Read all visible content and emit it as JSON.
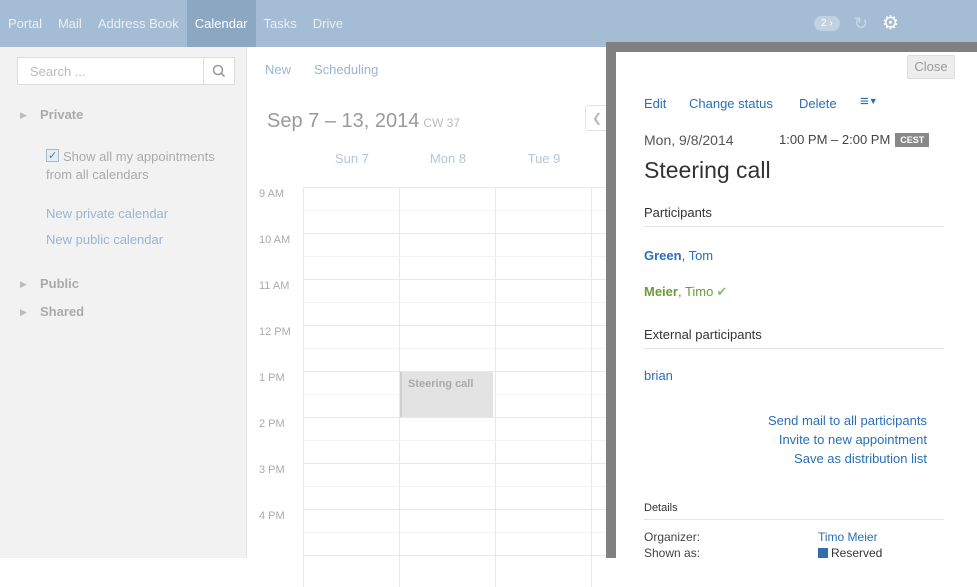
{
  "nav": {
    "tabs": [
      "Portal",
      "Mail",
      "Address Book",
      "Calendar",
      "Tasks",
      "Drive"
    ],
    "active": "Calendar",
    "notification_count": "2 ›"
  },
  "sidebar": {
    "search_placeholder": "Search ...",
    "sections": {
      "private": "Private",
      "public": "Public",
      "shared": "Shared"
    },
    "show_all_label": "Show all my appointments from all calendars",
    "new_private_calendar": "New private calendar",
    "new_public_calendar": "New public calendar"
  },
  "toolbar": {
    "new": "New",
    "scheduling": "Scheduling"
  },
  "calendar": {
    "range": "Sep 7 – 13, 2014",
    "cw": "CW 37",
    "days": [
      "Sun 7",
      "Mon 8",
      "Tue 9"
    ],
    "times": [
      "9 AM",
      "10 AM",
      "11 AM",
      "12 PM",
      "1 PM",
      "2 PM",
      "3 PM",
      "4 PM"
    ],
    "event_title": "Steering call"
  },
  "popup": {
    "close": "Close",
    "actions": {
      "edit": "Edit",
      "change_status": "Change status",
      "delete": "Delete"
    },
    "date": "Mon, 9/8/2014",
    "time": "1:00 PM – 2:00 PM",
    "timezone": "CEST",
    "title": "Steering call",
    "participants_header": "Participants",
    "participants": [
      {
        "last": "Green",
        "first": ", Tom"
      },
      {
        "last": "Meier",
        "first": ", Timo"
      }
    ],
    "external_header": "External participants",
    "external": [
      "brian"
    ],
    "links": {
      "send_mail": "Send mail to all participants",
      "invite": "Invite to new appointment",
      "save_list": "Save as distribution list"
    },
    "details_header": "Details",
    "details": {
      "organizer_label": "Organizer:",
      "organizer": "Timo Meier",
      "shown_as_label": "Shown as:",
      "shown_as": "Reserved"
    },
    "colors": {
      "link": "#2a6fb5",
      "accepted": "#6b9a3a",
      "reserved": "#2f6ea7"
    }
  }
}
